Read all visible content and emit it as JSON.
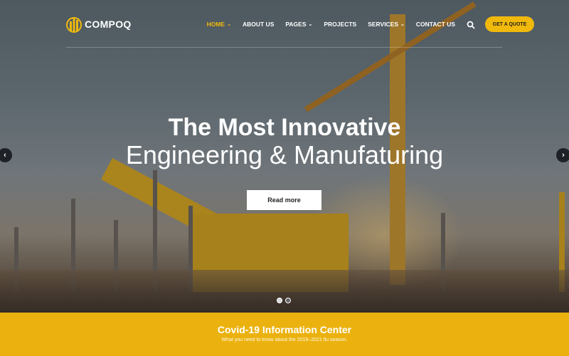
{
  "brand": {
    "name": "COMPOQ",
    "accent": "#f0b90b"
  },
  "nav": {
    "items": [
      {
        "label": "HOME",
        "has_dropdown": true,
        "active": true
      },
      {
        "label": "ABOUT US",
        "has_dropdown": false
      },
      {
        "label": "PAGES",
        "has_dropdown": true
      },
      {
        "label": "PROJECTS",
        "has_dropdown": false
      },
      {
        "label": "SERVICES",
        "has_dropdown": true
      },
      {
        "label": "CONTACT US",
        "has_dropdown": false
      }
    ],
    "search_icon": "search-icon",
    "cta_label": "GET A QUOTE"
  },
  "hero": {
    "title_line1": "The Most Innovative",
    "title_line2": "Engineering & Manufaturing",
    "button_label": "Read more",
    "prev_arrow": "‹",
    "next_arrow": "›",
    "slides": 2,
    "active_slide": 1
  },
  "covid": {
    "title": "Covid-19 Information Center",
    "subtitle": "What you need to know about the 2019–2021 flu season."
  }
}
